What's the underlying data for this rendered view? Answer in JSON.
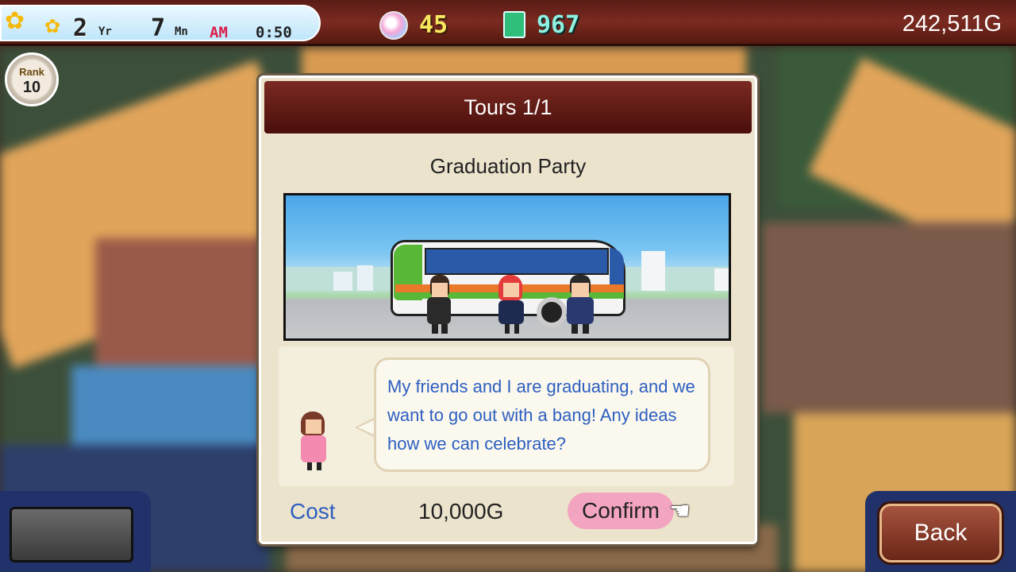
{
  "status_bar": {
    "year_value": "2",
    "year_unit": "Yr",
    "month_value": "7",
    "month_unit": "Mn",
    "ampm": "AM",
    "time": "0:50",
    "medal_count": "45",
    "ticket_count": "967",
    "gold": "242,511G"
  },
  "rank": {
    "label": "Rank",
    "value": "10"
  },
  "dialog": {
    "title": "Tours 1/1",
    "tour_name": "Graduation Party",
    "message": "My friends and I are graduating, and we want to go out with a bang! Any ideas how we can celebrate?",
    "cost_label": "Cost",
    "cost_value": "10,000G",
    "confirm_label": "Confirm"
  },
  "buttons": {
    "back_label": "Back"
  },
  "colors": {
    "header_dark": "#4a0e0a",
    "dialog_bg": "#ece3cd",
    "message_blue": "#2d5fc0",
    "confirm_pink": "#f3a4c0",
    "back_brown": "#8a3a28"
  },
  "icons": [
    "sunflower-icon",
    "medal-icon",
    "ticket-icon",
    "hand-pointer-icon"
  ]
}
